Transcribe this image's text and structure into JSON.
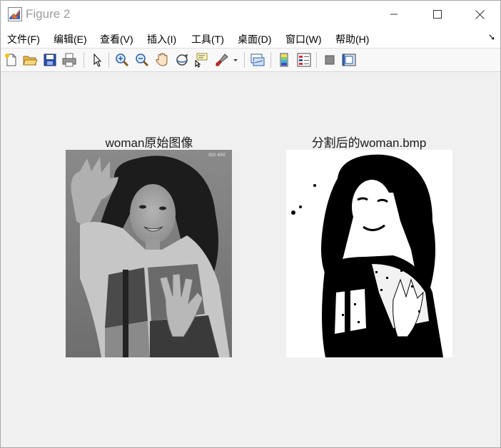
{
  "window": {
    "title": "Figure 2"
  },
  "menubar": {
    "items": [
      {
        "label": "文件(F)"
      },
      {
        "label": "编辑(E)"
      },
      {
        "label": "查看(V)"
      },
      {
        "label": "插入(I)"
      },
      {
        "label": "工具(T)"
      },
      {
        "label": "桌面(D)"
      },
      {
        "label": "窗口(W)"
      },
      {
        "label": "帮助(H)"
      }
    ]
  },
  "toolbar": {
    "icons": [
      "new-figure-icon",
      "open-file-icon",
      "save-icon",
      "print-icon",
      "select-pointer-icon",
      "zoom-in-icon",
      "zoom-out-icon",
      "pan-hand-icon",
      "rotate-3d-icon",
      "data-cursor-icon",
      "brush-icon",
      "brush-dropdown-icon",
      "link-plot-icon",
      "insert-colorbar-icon",
      "insert-legend-icon",
      "hide-plot-tools-icon",
      "show-plot-tools-icon"
    ]
  },
  "figure": {
    "left_axes": {
      "title": "woman原始图像",
      "watermark": "ISO 400"
    },
    "right_axes": {
      "title": "分割后的woman.bmp"
    }
  }
}
